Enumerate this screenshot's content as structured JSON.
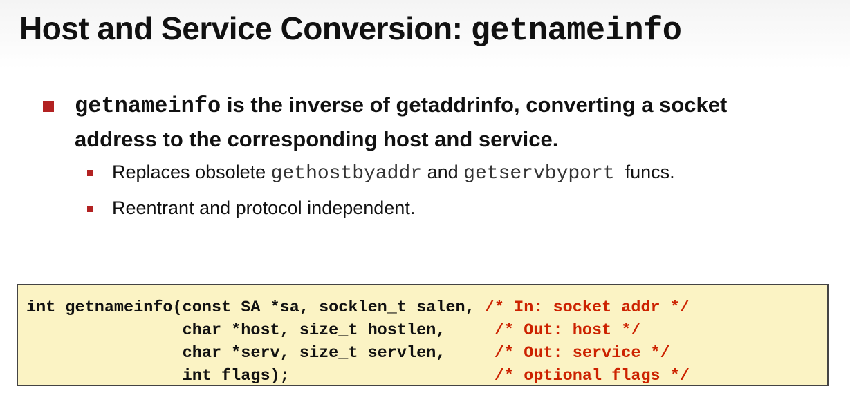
{
  "slide": {
    "title_text": "Host and Service Conversion: ",
    "title_mono": "getnameinfo",
    "bullet": {
      "mono": "getnameinfo",
      "text": " is the inverse of getaddrinfo, converting a socket address to the corresponding host and service."
    },
    "sub_bullets": [
      {
        "pre": "Replaces obsolete ",
        "mono1": "gethostbyaddr",
        "mid": " and ",
        "mono2": "getservbyport",
        "post": "  funcs."
      },
      {
        "text": "Reentrant and protocol independent."
      }
    ],
    "code": {
      "lines": [
        {
          "code": "int getnameinfo(const SA *sa, socklen_t salen, ",
          "comment": "/* In: socket addr */"
        },
        {
          "code": "                char *host, size_t hostlen,     ",
          "comment": "/* Out: host */"
        },
        {
          "code": "                char *serv, size_t servlen,     ",
          "comment": "/* Out: service */"
        },
        {
          "code": "                int flags);                     ",
          "comment": "/* optional flags */"
        }
      ]
    },
    "colors": {
      "accent": "#b22222",
      "code_bg": "#fbf3c4",
      "comment": "#cc2200"
    }
  }
}
